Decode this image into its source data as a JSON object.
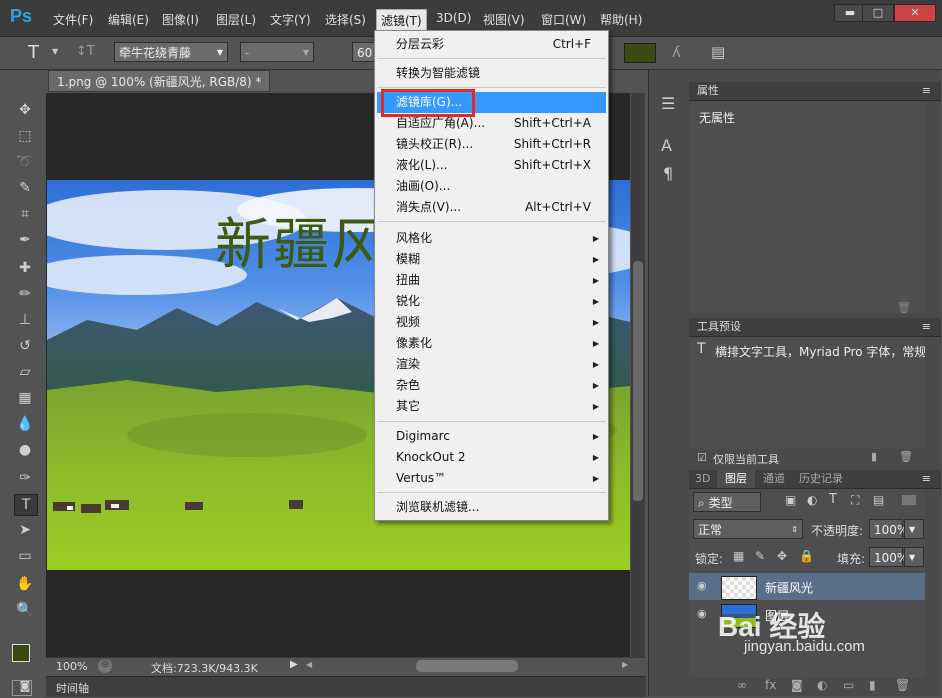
{
  "app": {
    "logo": "Ps"
  },
  "menubar": {
    "items": [
      "文件(F)",
      "编辑(E)",
      "图像(I)",
      "图层(L)",
      "文字(Y)",
      "选择(S)",
      "滤镜(T)",
      "3D(D)",
      "视图(V)",
      "窗口(W)",
      "帮助(H)"
    ],
    "active_index": 6,
    "window_controls": [
      "▬",
      "□",
      "✕"
    ]
  },
  "options": {
    "tool_icon": "T",
    "orient_icon": "↕T",
    "font_family": "牵牛花绕青藤",
    "font_style": "-",
    "font_size": "60"
  },
  "document": {
    "tab_title": "1.png @ 100% (新疆风光, RGB/8) *",
    "overlay_text": "新疆风",
    "zoom": "100%",
    "doc_info": "文档:723.3K/943.3K",
    "timeline_label": "时间轴"
  },
  "filter_menu": {
    "items": [
      {
        "label": "分层云彩",
        "shortcut": "Ctrl+F"
      },
      {
        "label": "转换为智能滤镜",
        "shortcut": ""
      },
      {
        "label": "滤镜库(G)...",
        "shortcut": "",
        "highlighted": true
      },
      {
        "label": "自适应广角(A)...",
        "shortcut": "Shift+Ctrl+A"
      },
      {
        "label": "镜头校正(R)...",
        "shortcut": "Shift+Ctrl+R"
      },
      {
        "label": "液化(L)...",
        "shortcut": "Shift+Ctrl+X"
      },
      {
        "label": "油画(O)...",
        "shortcut": ""
      },
      {
        "label": "消失点(V)...",
        "shortcut": "Alt+Ctrl+V"
      },
      {
        "label": "风格化",
        "submenu": true
      },
      {
        "label": "模糊",
        "submenu": true
      },
      {
        "label": "扭曲",
        "submenu": true
      },
      {
        "label": "锐化",
        "submenu": true
      },
      {
        "label": "视频",
        "submenu": true
      },
      {
        "label": "像素化",
        "submenu": true
      },
      {
        "label": "渲染",
        "submenu": true
      },
      {
        "label": "杂色",
        "submenu": true
      },
      {
        "label": "其它",
        "submenu": true
      },
      {
        "label": "Digimarc",
        "submenu": true
      },
      {
        "label": "KnockOut 2",
        "submenu": true
      },
      {
        "label": "Vertus™",
        "submenu": true
      },
      {
        "label": "浏览联机滤镜...",
        "shortcut": ""
      }
    ]
  },
  "properties_panel": {
    "title": "属性",
    "body": "无属性"
  },
  "tool_presets_panel": {
    "title": "工具预设",
    "entry": "横排文字工具，Myriad Pro 字体，常规",
    "only_current": "仅限当前工具"
  },
  "layers_panel": {
    "tabs": [
      "3D",
      "图层",
      "通道",
      "历史记录"
    ],
    "active_tab": 1,
    "kind_label": "类型",
    "blend_mode": "正常",
    "opacity_label": "不透明度:",
    "opacity": "100%",
    "lock_label": "锁定:",
    "fill_label": "填充:",
    "fill": "100%",
    "layers": [
      {
        "name": "新疆风光",
        "selected": true
      },
      {
        "name": "图层",
        "selected": false
      }
    ]
  },
  "watermark": {
    "text": "Bai 经验",
    "url": "jingyan.baidu.com"
  },
  "colors": {
    "foreground": "#3b4a12",
    "background": "#ffffff",
    "highlight": "#3399ff",
    "accent_red": "#e3282a"
  }
}
